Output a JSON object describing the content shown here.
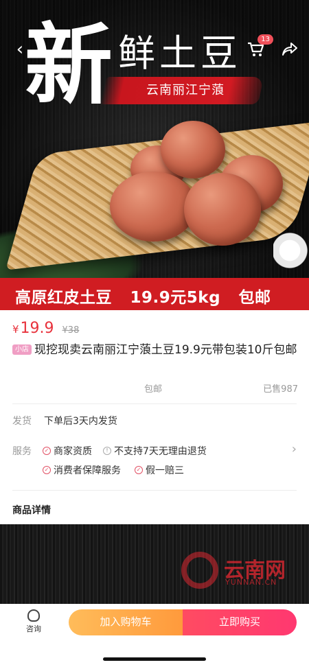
{
  "hero": {
    "big_char": "新",
    "title_rest": "鲜土豆",
    "region": "云南丽江宁蒗",
    "cart_count": "13",
    "banner_items": [
      "高原红皮土豆",
      "19.9元5kg",
      "包邮"
    ]
  },
  "product": {
    "currency": "¥",
    "price": "19.9",
    "original_price": "¥38",
    "shop_tag": "小店",
    "title": "现挖现卖云南丽江宁蒗土豆19.9元带包装10斤包邮",
    "shipping_fee": "包邮",
    "sold": "已售987"
  },
  "delivery": {
    "label": "发货",
    "text": "下单后3天内发货"
  },
  "service": {
    "label": "服务",
    "items": [
      "商家资质",
      "不支持7天无理由退货",
      "消费者保障服务",
      "假一赔三"
    ]
  },
  "details": {
    "heading": "商品详情"
  },
  "watermark": {
    "text": "云南网",
    "sub": "YUNNAN.CN"
  },
  "bottom": {
    "consult_label": "咨询",
    "add_cart_label": "加入购物车",
    "buy_label": "立即购买"
  },
  "colors": {
    "price": "#e8323c",
    "banner": "#d01d22",
    "buy_button": "#ff4b62",
    "cart_button": "#ffa744"
  }
}
